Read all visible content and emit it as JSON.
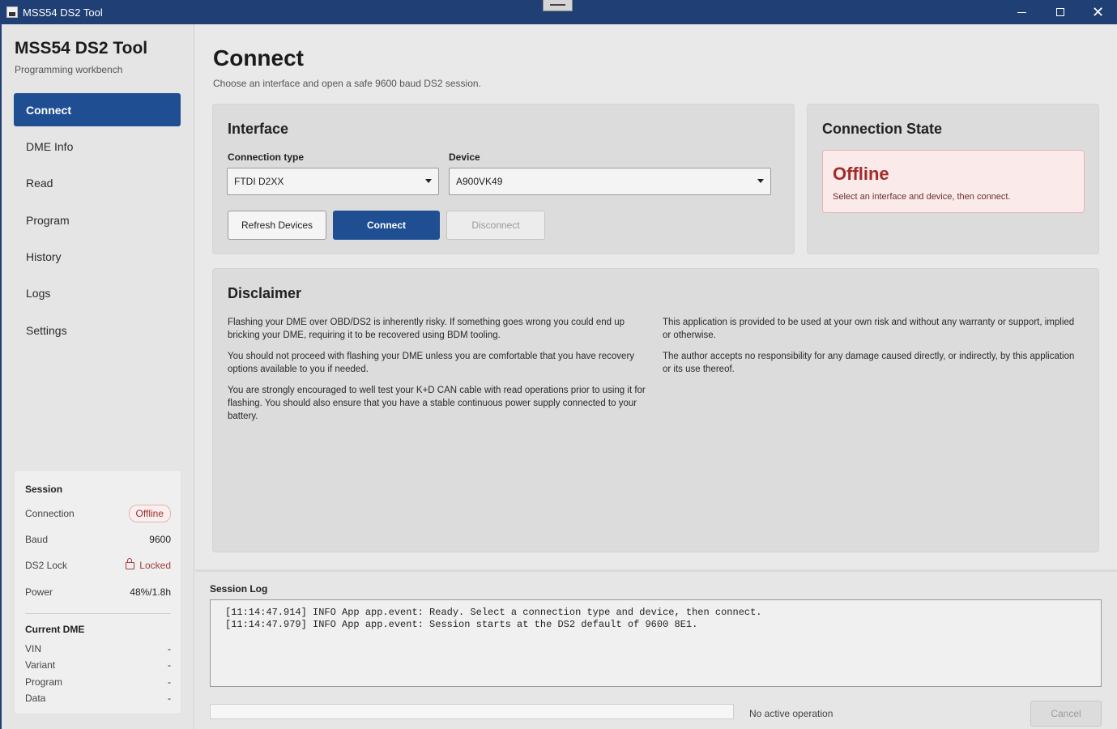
{
  "window": {
    "title": "MSS54 DS2 Tool"
  },
  "sidebar": {
    "brand_title": "MSS54 DS2 Tool",
    "brand_subtitle": "Programming workbench",
    "items": [
      {
        "label": "Connect",
        "active": true
      },
      {
        "label": "DME Info",
        "active": false
      },
      {
        "label": "Read",
        "active": false
      },
      {
        "label": "Program",
        "active": false
      },
      {
        "label": "History",
        "active": false
      },
      {
        "label": "Logs",
        "active": false
      },
      {
        "label": "Settings",
        "active": false
      }
    ],
    "session": {
      "heading": "Session",
      "connection_label": "Connection",
      "connection_value": "Offline",
      "baud_label": "Baud",
      "baud_value": "9600",
      "lock_label": "DS2 Lock",
      "lock_value": "Locked",
      "power_label": "Power",
      "power_value": "48%/1.8h"
    },
    "current_dme": {
      "heading": "Current DME",
      "rows": [
        {
          "label": "VIN",
          "value": "-"
        },
        {
          "label": "Variant",
          "value": "-"
        },
        {
          "label": "Program",
          "value": "-"
        },
        {
          "label": "Data",
          "value": "-"
        }
      ]
    }
  },
  "main": {
    "title": "Connect",
    "subtitle": "Choose an interface and open a safe 9600 baud DS2 session.",
    "interface": {
      "title": "Interface",
      "connection_type_label": "Connection type",
      "connection_type_value": "FTDI D2XX",
      "device_label": "Device",
      "device_value": "A900VK49",
      "refresh_label": "Refresh Devices",
      "connect_label": "Connect",
      "disconnect_label": "Disconnect"
    },
    "connection_state": {
      "title": "Connection State",
      "status": "Offline",
      "message": "Select an interface and device, then connect."
    },
    "disclaimer": {
      "title": "Disclaimer",
      "left": [
        "Flashing your DME over OBD/DS2 is inherently risky. If something goes wrong you could end up bricking your DME, requiring it to be recovered using BDM tooling.",
        "You should not proceed with flashing your DME unless you are comfortable that you have recovery options available to you if needed.",
        "You are strongly encouraged to well test your K+D CAN cable with read operations prior to using it for flashing. You should also ensure that you have a stable continuous power supply connected to your battery."
      ],
      "right": [
        "This application is provided to be used at your own risk and without any warranty or support, implied or otherwise.",
        "The author accepts no responsibility for any damage caused directly, or indirectly, by this application or its use thereof."
      ]
    }
  },
  "log": {
    "title": "Session Log",
    "lines": [
      "[11:14:47.914] INFO App app.event: Ready. Select a connection type and device, then connect.",
      "[11:14:47.979] INFO App app.event: Session starts at the DS2 default of 9600 8E1."
    ],
    "progress": 0,
    "status": "No active operation",
    "cancel_label": "Cancel"
  },
  "colors": {
    "accent": "#1f4e92",
    "titlebar": "#1f3f75",
    "offline": "#a12c2c"
  }
}
